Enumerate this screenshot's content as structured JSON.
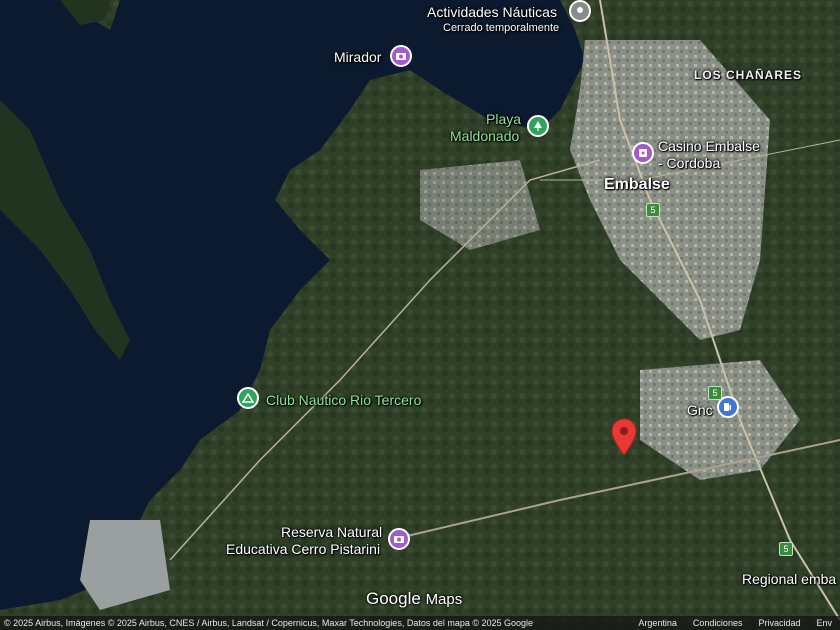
{
  "map": {
    "places": {
      "actividades": {
        "title": "Actividades Náuticas",
        "subtitle": "Cerrado temporalmente",
        "icon": "pin-gray-icon"
      },
      "mirador": {
        "title": "Mirador",
        "icon": "camera-icon"
      },
      "playa": {
        "line1": "Playa",
        "line2": "Maldonado",
        "icon": "park-icon"
      },
      "casino": {
        "line1": "Casino Embalse",
        "line2": "- Cordoba",
        "icon": "casino-icon"
      },
      "club": {
        "title": "Club Nautico Rio Tercero",
        "icon": "camping-icon"
      },
      "reserva": {
        "line1": "Reserva Natural",
        "line2": "Educativa Cerro Pistarini",
        "icon": "camera-icon"
      },
      "gnc": {
        "title": "Gnc",
        "icon": "gas-station-icon"
      },
      "regional": {
        "title": "Regional emba"
      }
    },
    "areas": {
      "los_chanares": "LOS CHAÑARES",
      "embalse": "Embalse"
    },
    "route_badges": [
      "5",
      "5",
      "5"
    ],
    "marker": {
      "icon": "red-location-pin-icon"
    },
    "colors": {
      "water": "#0b1a2e",
      "green_label": "#8fe39b",
      "pin_purple": "#a15cc9",
      "pin_green": "#2ea35a",
      "pin_blue": "#3f78d0",
      "marker_red": "#e53935"
    }
  },
  "branding": {
    "google": "Google",
    "maps": "Maps"
  },
  "footer": {
    "attribution": "© 2025 Airbus, Imágenes © 2025 Airbus, CNES / Airbus, Landsat / Copernicus, Maxar Technologies, Datos del mapa © 2025 Google",
    "links": [
      "Argentina",
      "Condiciones",
      "Privacidad",
      "Env"
    ]
  }
}
